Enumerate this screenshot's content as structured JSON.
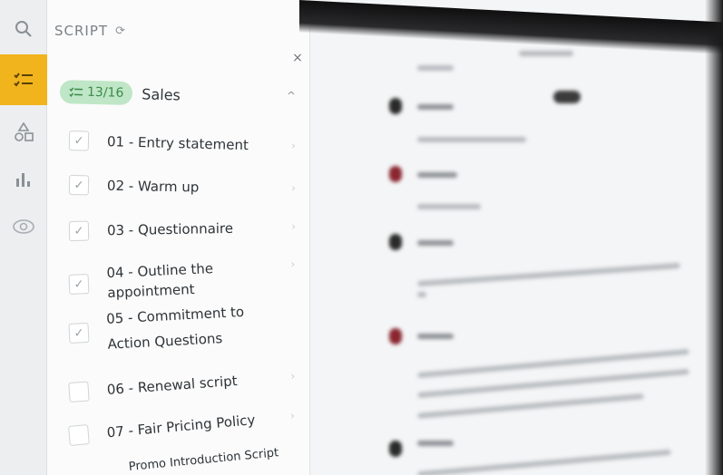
{
  "panel": {
    "title": "SCRIPT",
    "close_label": "×"
  },
  "group": {
    "progress": "13/16",
    "title": "Sales"
  },
  "steps": [
    {
      "label": "01 - Entry statement",
      "checked": true
    },
    {
      "label": "02 - Warm up",
      "checked": true
    },
    {
      "label": "03 - Questionnaire",
      "checked": true
    },
    {
      "label": "04 - Outline the appointment",
      "checked": true
    },
    {
      "label": "05 - Commitment to Action Questions",
      "checked": true
    },
    {
      "label": "06 - Renewal script",
      "checked": false
    },
    {
      "label": "07 - Fair Pricing Policy",
      "checked": false
    },
    {
      "label": "Promo Introduction Script",
      "checked": false
    }
  ],
  "icons": {
    "rail": [
      "search-icon",
      "checklist-icon",
      "shapes-icon",
      "bar-chart-icon",
      "eye-icon"
    ],
    "reload": "reload-icon",
    "chevron": "chevron-right-icon"
  },
  "colors": {
    "accent": "#f2b41d",
    "badge_bg": "#bfe6c6",
    "badge_text": "#3d8a4c",
    "speaker_dark": "#2a2a2a",
    "speaker_red": "#8a2630"
  }
}
